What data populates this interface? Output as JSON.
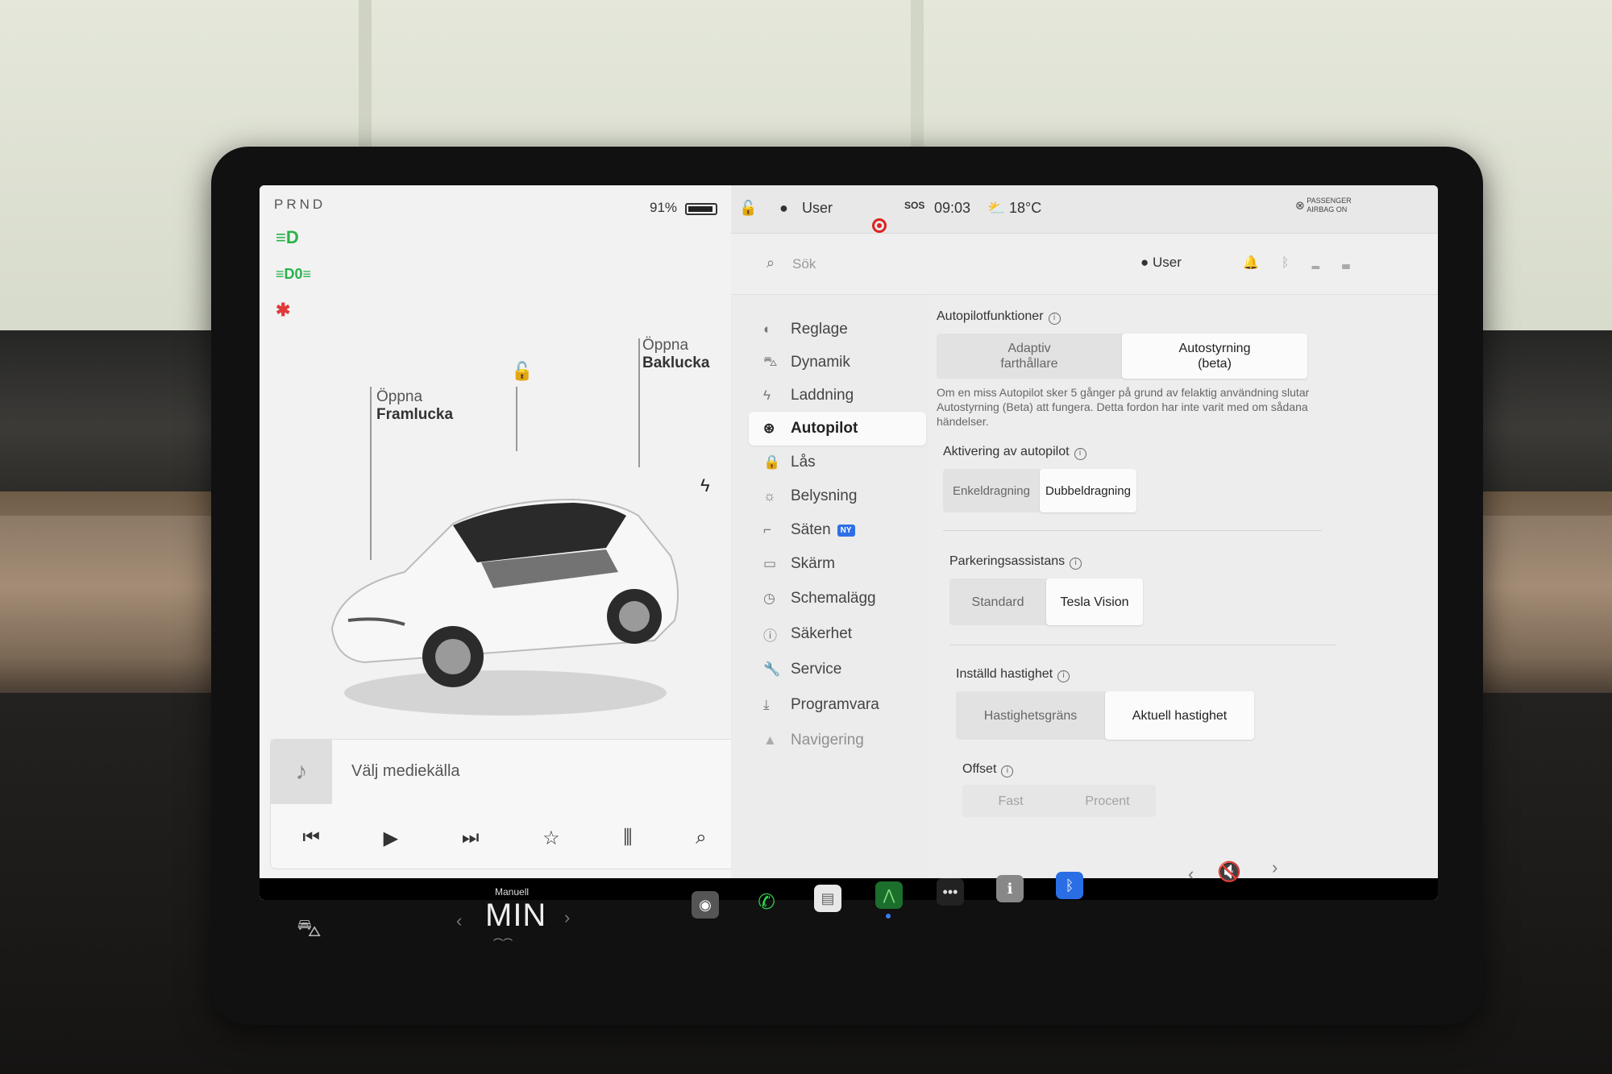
{
  "left_panel": {
    "gear": "PRND",
    "battery_pct": "91%",
    "open_frunk_line1": "Öppna",
    "open_frunk_line2": "Framlucka",
    "open_trunk_line1": "Öppna",
    "open_trunk_line2": "Baklucka",
    "media_prompt": "Välj mediekälla"
  },
  "status_bar": {
    "profile": "User",
    "sos": "SOS",
    "time": "09:03",
    "temperature": "18°C",
    "airbag_line1": "PASSENGER",
    "airbag_line2": "AIRBAG ON"
  },
  "search": {
    "placeholder": "Sök",
    "profile": "User"
  },
  "nav": {
    "items": [
      {
        "label": "Reglage",
        "icon": "toggle-icon"
      },
      {
        "label": "Dynamik",
        "icon": "car-icon"
      },
      {
        "label": "Laddning",
        "icon": "bolt-icon"
      },
      {
        "label": "Autopilot",
        "icon": "steering-wheel-icon"
      },
      {
        "label": "Lås",
        "icon": "lock-icon"
      },
      {
        "label": "Belysning",
        "icon": "sun-icon"
      },
      {
        "label": "Säten",
        "icon": "seat-icon",
        "badge": "NY"
      },
      {
        "label": "Skärm",
        "icon": "display-icon"
      },
      {
        "label": "Schemalägg",
        "icon": "clock-icon"
      },
      {
        "label": "Säkerhet",
        "icon": "info-circle-icon"
      },
      {
        "label": "Service",
        "icon": "wrench-icon"
      },
      {
        "label": "Programvara",
        "icon": "download-icon"
      },
      {
        "label": "Navigering",
        "icon": "navigation-icon"
      }
    ],
    "active": "Autopilot"
  },
  "settings": {
    "autopilot_features_title": "Autopilotfunktioner",
    "autopilot_opt1_line1": "Adaptiv",
    "autopilot_opt1_line2": "farthållare",
    "autopilot_opt2_line1": "Autostyrning",
    "autopilot_opt2_line2": "(beta)",
    "autopilot_desc": "Om en miss Autopilot sker 5 gånger på grund av felaktig användning slutar Autostyrning (Beta) att fungera. Detta fordon har inte varit med om sådana händelser.",
    "activation_title": "Aktivering av autopilot",
    "activation_opt1": "Enkeldragning",
    "activation_opt2": "Dubbeldragning",
    "parking_title": "Parkeringsassistans",
    "parking_opt1": "Standard",
    "parking_opt2": "Tesla Vision",
    "speed_title": "Inställd hastighet",
    "speed_opt1": "Hastighetsgräns",
    "speed_opt2": "Aktuell hastighet",
    "offset_title": "Offset",
    "offset_opt1": "Fast",
    "offset_opt2": "Procent"
  },
  "dock": {
    "climate_mode": "Manuell",
    "climate_value": "MIN"
  }
}
